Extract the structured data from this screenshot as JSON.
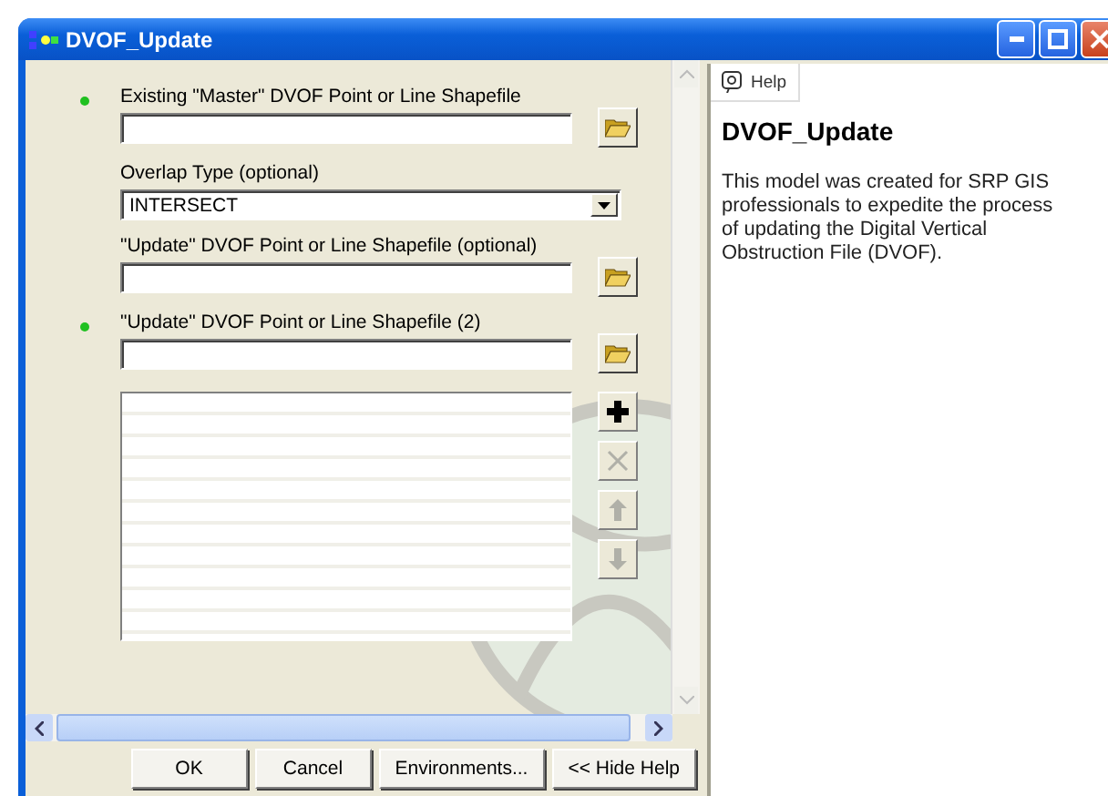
{
  "window": {
    "title": "DVOF_Update"
  },
  "parameters": [
    {
      "kind": "file",
      "label": "Existing \"Master\" DVOF Point or Line Shapefile",
      "required": true
    },
    {
      "kind": "dropdown",
      "label": "Overlap Type (optional)",
      "value": "INTERSECT",
      "required": false
    },
    {
      "kind": "file",
      "label": "\"Update\" DVOF Point or Line Shapefile (optional)",
      "required": false
    },
    {
      "kind": "file",
      "label": "\"Update\" DVOF Point or Line Shapefile (2)",
      "required": true,
      "list_buttons": [
        {
          "kind": "add",
          "disabled": false
        },
        {
          "kind": "remove",
          "disabled": true
        },
        {
          "kind": "up",
          "disabled": true
        },
        {
          "kind": "down",
          "disabled": true
        }
      ]
    }
  ],
  "buttons": [
    "OK",
    "Cancel",
    "Environments...",
    "<< Hide Help"
  ],
  "help": {
    "tab": "Help",
    "title": "DVOF_Update",
    "body": "This model was created for SRP GIS professionals to expedite the process of updating the Digital Vertical Obstruction File (DVOF)."
  }
}
